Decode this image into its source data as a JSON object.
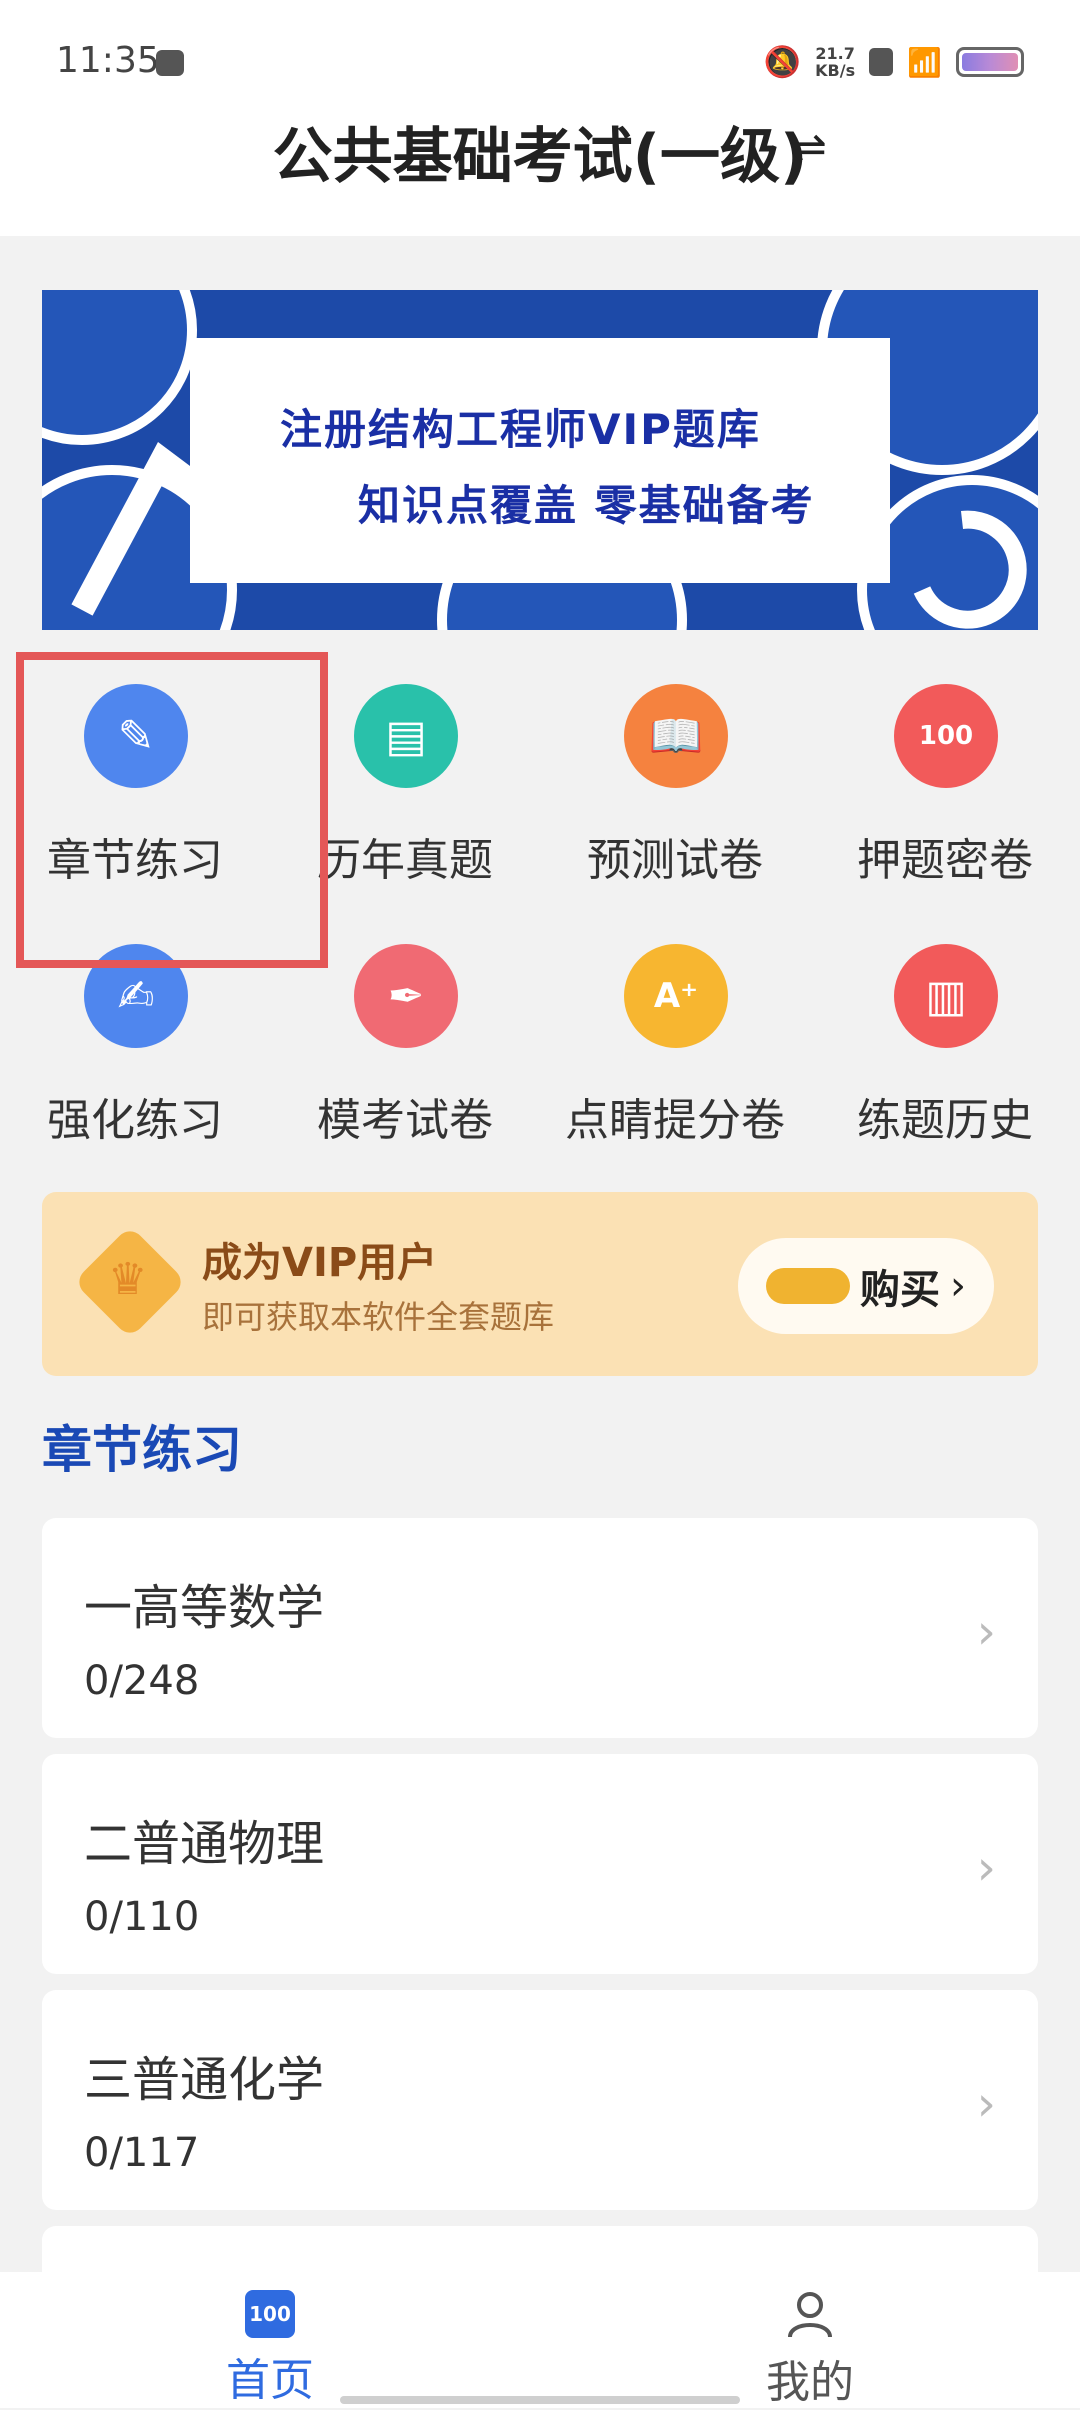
{
  "status_bar": {
    "time": "11:35",
    "speed_value": "21.7",
    "speed_unit": "KB/s"
  },
  "header": {
    "title": "公共基础考试(一级)",
    "switch_icon": "⇌"
  },
  "banner": {
    "line1": "注册结构工程师VIP题库",
    "line2": "知识点覆盖  零基础备考"
  },
  "grid": [
    {
      "label": "章节练习",
      "icon": "edit-icon",
      "color": "#4f86ee"
    },
    {
      "label": "历年真题",
      "icon": "document-icon",
      "color": "#29c1aa"
    },
    {
      "label": "预测试卷",
      "icon": "book-icon",
      "color": "#f5823f"
    },
    {
      "label": "押题密卷",
      "icon": "score-100-icon",
      "color": "#f25a5a"
    },
    {
      "label": "强化练习",
      "icon": "note-edit-icon",
      "color": "#4f86ee"
    },
    {
      "label": "模考试卷",
      "icon": "pen-icon",
      "color": "#f06a73"
    },
    {
      "label": "点睛提分卷",
      "icon": "grade-a-plus-icon",
      "color": "#f7b630"
    },
    {
      "label": "练题历史",
      "icon": "history-icon",
      "color": "#f25a5a"
    }
  ],
  "vip": {
    "title": "成为VIP用户",
    "subtitle": "即可获取本软件全套题库",
    "buy_label": "购买"
  },
  "section_title": "章节练习",
  "chapters": [
    {
      "name": "一高等数学",
      "progress": "0/248"
    },
    {
      "name": "二普通物理",
      "progress": "0/110"
    },
    {
      "name": "三普通化学",
      "progress": "0/117"
    }
  ],
  "bottom_nav": {
    "home_label": "首页",
    "home_icon_text": "100",
    "mine_label": "我的"
  }
}
